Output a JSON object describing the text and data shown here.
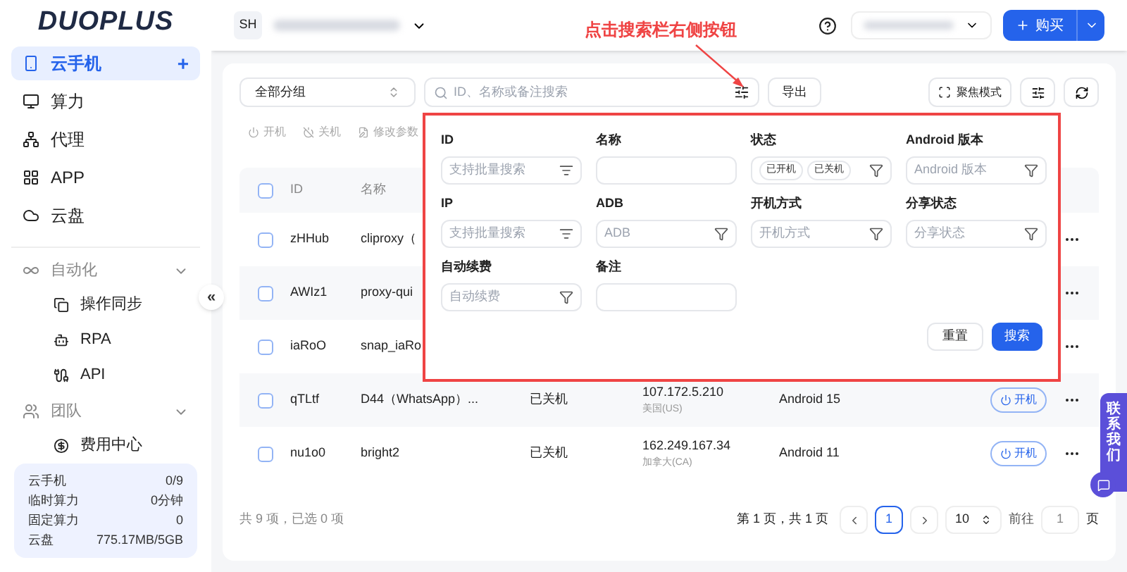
{
  "logo": "DUOPLUS",
  "account": {
    "initials": "SH"
  },
  "sidebar": {
    "items": [
      {
        "label": "云手机",
        "selected": true,
        "kind": "item",
        "add": "+"
      },
      {
        "label": "算力",
        "selected": false,
        "kind": "item"
      },
      {
        "label": "代理",
        "selected": false,
        "kind": "item"
      },
      {
        "label": "APP",
        "selected": false,
        "kind": "item"
      },
      {
        "label": "云盘",
        "selected": false,
        "kind": "item"
      },
      {
        "label": "自动化",
        "selected": false,
        "kind": "group",
        "expanded": true,
        "children": [
          {
            "label": "操作同步",
            "selected": false
          },
          {
            "label": "RPA",
            "selected": false
          },
          {
            "label": "API",
            "selected": false
          }
        ]
      },
      {
        "label": "团队",
        "selected": false,
        "kind": "group",
        "expanded": true,
        "children": [
          {
            "label": "费用中心",
            "selected": false
          }
        ]
      }
    ]
  },
  "usage": [
    {
      "label": "云手机",
      "value": "0/9"
    },
    {
      "label": "临时算力",
      "value": "0分钟"
    },
    {
      "label": "固定算力",
      "value": "0"
    },
    {
      "label": "云盘",
      "value": "775.17MB/5GB"
    }
  ],
  "collapse": "«",
  "header": {
    "buy": "购买"
  },
  "annotation": "点击搜索栏右侧按钮",
  "toolbar": {
    "group_select": "全部分组",
    "search_placeholder": "ID、名称或备注搜索",
    "export": "导出",
    "focus_mode": "聚焦模式"
  },
  "actions": [
    {
      "label": "开机",
      "disabled": true
    },
    {
      "label": "关机",
      "disabled": true
    },
    {
      "label": "修改参数",
      "disabled": true
    }
  ],
  "table": {
    "all_selected": false,
    "columns": [
      "ID",
      "名称"
    ],
    "rows": [
      {
        "selected": false,
        "id": "zHHub",
        "name": "cliproxy（"
      },
      {
        "selected": false,
        "id": "AWIz1",
        "name": "proxy-qui"
      },
      {
        "selected": false,
        "id": "iaRoO",
        "name": "snap_iaRo"
      },
      {
        "selected": false,
        "id": "qTLtf",
        "name": "D44（WhatsApp）...",
        "status": "已关机",
        "ip": "107.172.5.210",
        "region": "美国(US)",
        "android": "Android 15",
        "action": "开机"
      },
      {
        "selected": false,
        "id": "nu1o0",
        "name": "bright2",
        "status": "已关机",
        "ip": "162.249.167.34",
        "region": "加拿大(CA)",
        "android": "Android 11",
        "action": "开机"
      }
    ]
  },
  "summary": "共 9 项，已选 0 项",
  "pagination": {
    "info": "第 1 页，共 1 页",
    "pages": [
      {
        "label": "1",
        "selected": true
      }
    ],
    "page_size": "10",
    "goto_label": "前往",
    "goto_value": "1",
    "goto_suffix": "页"
  },
  "filter": {
    "fields": [
      {
        "label": "ID",
        "kind": "search",
        "placeholder": "支持批量搜索"
      },
      {
        "label": "名称",
        "kind": "text"
      },
      {
        "label": "状态",
        "kind": "chips",
        "chips": [
          "已开机",
          "已关机"
        ]
      },
      {
        "label": "Android 版本",
        "kind": "select",
        "placeholder": "Android 版本"
      },
      {
        "label": "IP",
        "kind": "search",
        "placeholder": "支持批量搜索"
      },
      {
        "label": "ADB",
        "kind": "select",
        "placeholder": "ADB"
      },
      {
        "label": "开机方式",
        "kind": "select",
        "placeholder": "开机方式"
      },
      {
        "label": "分享状态",
        "kind": "select",
        "placeholder": "分享状态"
      },
      {
        "label": "自动续费",
        "kind": "select",
        "placeholder": "自动续费"
      },
      {
        "label": "备注",
        "kind": "text"
      }
    ],
    "reset": "重置",
    "search": "搜索"
  },
  "contact": "联系我们"
}
